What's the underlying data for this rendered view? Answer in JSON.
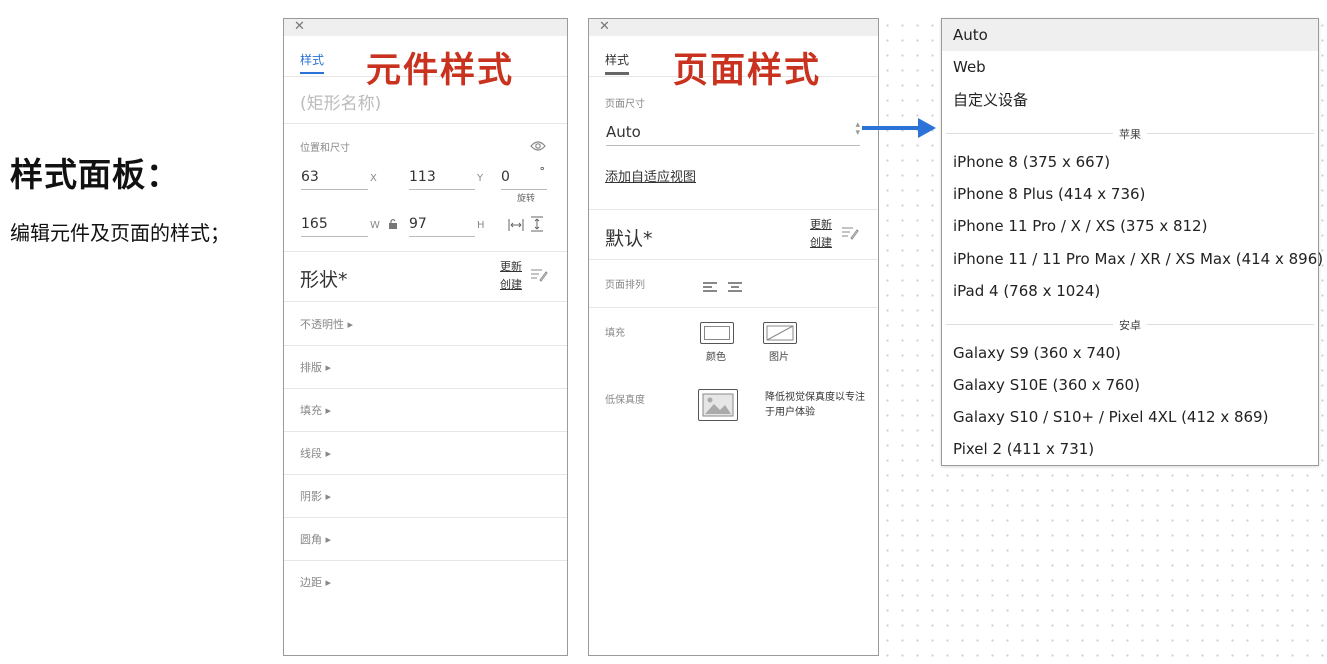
{
  "intro": {
    "title": "样式面板：",
    "desc": "编辑元件及页面的样式；"
  },
  "panel1": {
    "tab": "样式",
    "big_label": "元件样式",
    "name_placeholder": "(矩形名称)",
    "position_size_label": "位置和尺寸",
    "x_value": "63",
    "x_label": "X",
    "y_value": "113",
    "y_label": "Y",
    "rotate_value": "0",
    "rotate_unit": "°",
    "rotate_label": "旋转",
    "w_value": "165",
    "w_label": "W",
    "h_value": "97",
    "h_label": "H",
    "style_name": "形状*",
    "update_link": "更新",
    "create_link": "创建",
    "sections": [
      "不透明性 ▸",
      "排版 ▸",
      "填充 ▸",
      "线段 ▸",
      "阴影 ▸",
      "圆角 ▸",
      "边距 ▸"
    ]
  },
  "panel2": {
    "tab": "样式",
    "big_label": "页面样式",
    "page_size_label": "页面尺寸",
    "page_size_value": "Auto",
    "adaptive_link": "添加自适应视图",
    "style_name": "默认*",
    "update_link": "更新",
    "create_link": "创建",
    "arrange_label": "页面排列",
    "fill_label": "填充",
    "fill_color_label": "颜色",
    "fill_image_label": "图片",
    "lowfi_label": "低保真度",
    "lowfi_desc_1": "降低视觉保真度以专注",
    "lowfi_desc_2": "于用户体验"
  },
  "dropdown": {
    "items_top": [
      "Auto",
      "Web",
      "自定义设备"
    ],
    "group_apple": "苹果",
    "items_apple": [
      "iPhone 8  (375 x 667)",
      "iPhone 8 Plus  (414 x 736)",
      "iPhone 11 Pro / X / XS  (375 x 812)",
      "iPhone 11 / 11 Pro Max / XR / XS Max  (414 x 896)",
      "iPad 4  (768 x 1024)"
    ],
    "group_android": "安卓",
    "items_android": [
      "Galaxy S9  (360 x 740)",
      "Galaxy S10E  (360 x 760)",
      "Galaxy S10 / S10+ / Pixel 4XL  (412 x 869)",
      "Pixel 2  (411 x 731)"
    ]
  },
  "colors": {
    "accent_blue": "#2b73d6",
    "label_red": "#c8321e"
  }
}
